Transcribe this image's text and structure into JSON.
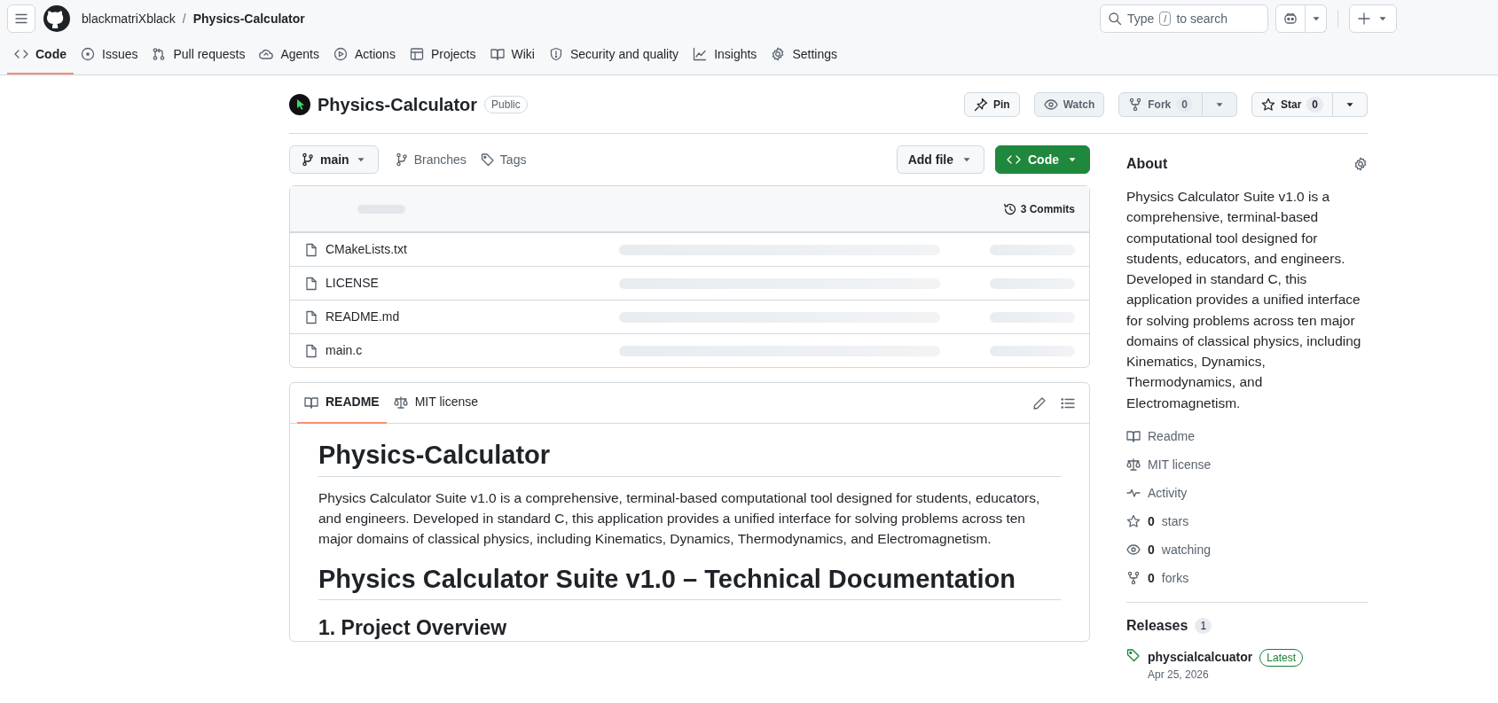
{
  "header": {
    "owner": "blackmatriXblack",
    "separator": "/",
    "repo": "Physics-Calculator",
    "search": {
      "placeholder": "Type",
      "shortcut": "/",
      "placeholder_end": "to search"
    }
  },
  "nav_tabs": [
    {
      "label": "Code",
      "selected": true
    },
    {
      "label": "Issues",
      "selected": false
    },
    {
      "label": "Pull requests",
      "selected": false
    },
    {
      "label": "Agents",
      "selected": false
    },
    {
      "label": "Actions",
      "selected": false
    },
    {
      "label": "Projects",
      "selected": false
    },
    {
      "label": "Wiki",
      "selected": false
    },
    {
      "label": "Security and quality",
      "selected": false
    },
    {
      "label": "Insights",
      "selected": false
    },
    {
      "label": "Settings",
      "selected": false
    }
  ],
  "repo": {
    "name": "Physics-Calculator",
    "visibility": "Public",
    "actions": [
      {
        "kind": "plain",
        "label": "Pin",
        "disabled": false
      },
      {
        "kind": "plain",
        "label": "Watch",
        "disabled": true
      },
      {
        "kind": "split",
        "label": "Fork",
        "count": "0",
        "disabled": true
      },
      {
        "kind": "split",
        "label": "Star",
        "count": "0",
        "disabled": false
      }
    ]
  },
  "branch_bar": {
    "branch": "main",
    "links": [
      "Branches",
      "Tags"
    ],
    "add_file": "Add file",
    "code_button": "Code"
  },
  "files": {
    "loading": true,
    "commits": "3 Commits",
    "rows": [
      {
        "name": "CMakeLists.txt"
      },
      {
        "name": "LICENSE"
      },
      {
        "name": "README.md"
      },
      {
        "name": "main.c"
      }
    ]
  },
  "readme": {
    "tabs": [
      {
        "label": "README",
        "selected": true
      },
      {
        "label": "MIT license",
        "selected": false
      }
    ],
    "blocks": [
      {
        "kind": "h1",
        "text": "Physics-Calculator"
      },
      {
        "kind": "p",
        "text": "Physics Calculator Suite v1.0 is a comprehensive, terminal-based computational tool designed for students, educators, and engineers. Developed in standard C, this application provides a unified interface for solving problems across ten major domains of classical physics, including Kinematics, Dynamics, Thermodynamics, and Electromagnetism."
      },
      {
        "kind": "h1",
        "text": "Physics Calculator Suite v1.0 – Technical Documentation"
      },
      {
        "kind": "h2",
        "text": "1. Project Overview"
      }
    ]
  },
  "about": {
    "title": "About",
    "description": "Physics Calculator Suite v1.0 is a comprehensive, terminal-based computational tool designed for students, educators, and engineers. Developed in standard C, this application provides a unified interface for solving problems across ten major domains of classical physics, including Kinematics, Dynamics, Thermodynamics, and Electromagnetism.",
    "links": [
      {
        "label": "Readme"
      },
      {
        "label": "MIT license"
      },
      {
        "label": "Activity"
      },
      {
        "count": "0",
        "label": "stars"
      },
      {
        "count": "0",
        "label": "watching"
      },
      {
        "count": "0",
        "label": "forks"
      }
    ]
  },
  "releases": {
    "title": "Releases",
    "count": "1",
    "items": [
      {
        "name": "physcialcalcuator",
        "badge": "Latest",
        "date": "Apr 25, 2026"
      }
    ]
  }
}
